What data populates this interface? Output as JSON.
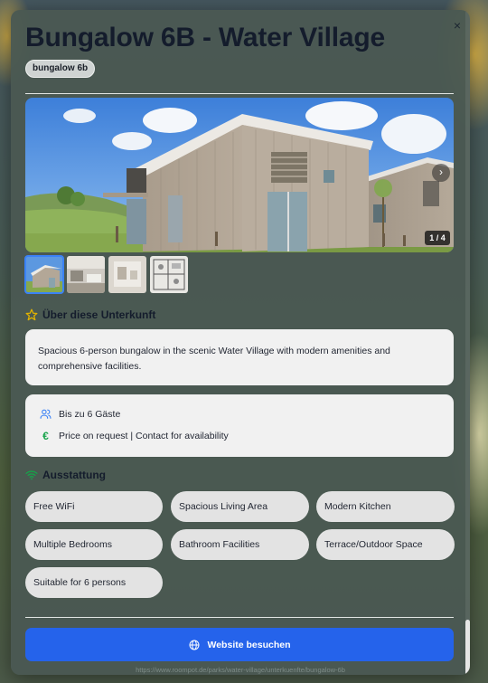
{
  "title": "Bungalow 6B - Water Village",
  "tag": "bungalow 6b",
  "close_label": "×",
  "gallery": {
    "counter": "1 / 4",
    "next_label": "›",
    "total_images": 4,
    "active_index": 1
  },
  "about": {
    "heading": "Über diese Unterkunft",
    "icon": "star-icon",
    "description": "Spacious 6-person bungalow in the scenic Water Village with modern amenities and comprehensive facilities."
  },
  "info": {
    "guests": "Bis zu 6 Gäste",
    "guests_icon": "users-icon",
    "price": "Price on request | Contact for availability",
    "price_icon": "euro-icon"
  },
  "amenities": {
    "heading": "Ausstattung",
    "icon": "wifi-icon",
    "items": [
      "Free WiFi",
      "Spacious Living Area",
      "Modern Kitchen",
      "Multiple Bedrooms",
      "Bathroom Facilities",
      "Terrace/Outdoor Space",
      "Suitable for 6 persons"
    ]
  },
  "website_button": "Website besuchen",
  "website_icon": "globe-icon",
  "url": "https://www.roompot.de/parks/water-village/unterkuenfte/bungalow-6b",
  "colors": {
    "primary_button": "#2563eb",
    "title": "#141c2c",
    "star_accent": "#e0b100",
    "wifi_accent": "#16a34a",
    "euro_accent": "#16a34a",
    "users_accent": "#3b82f6"
  }
}
